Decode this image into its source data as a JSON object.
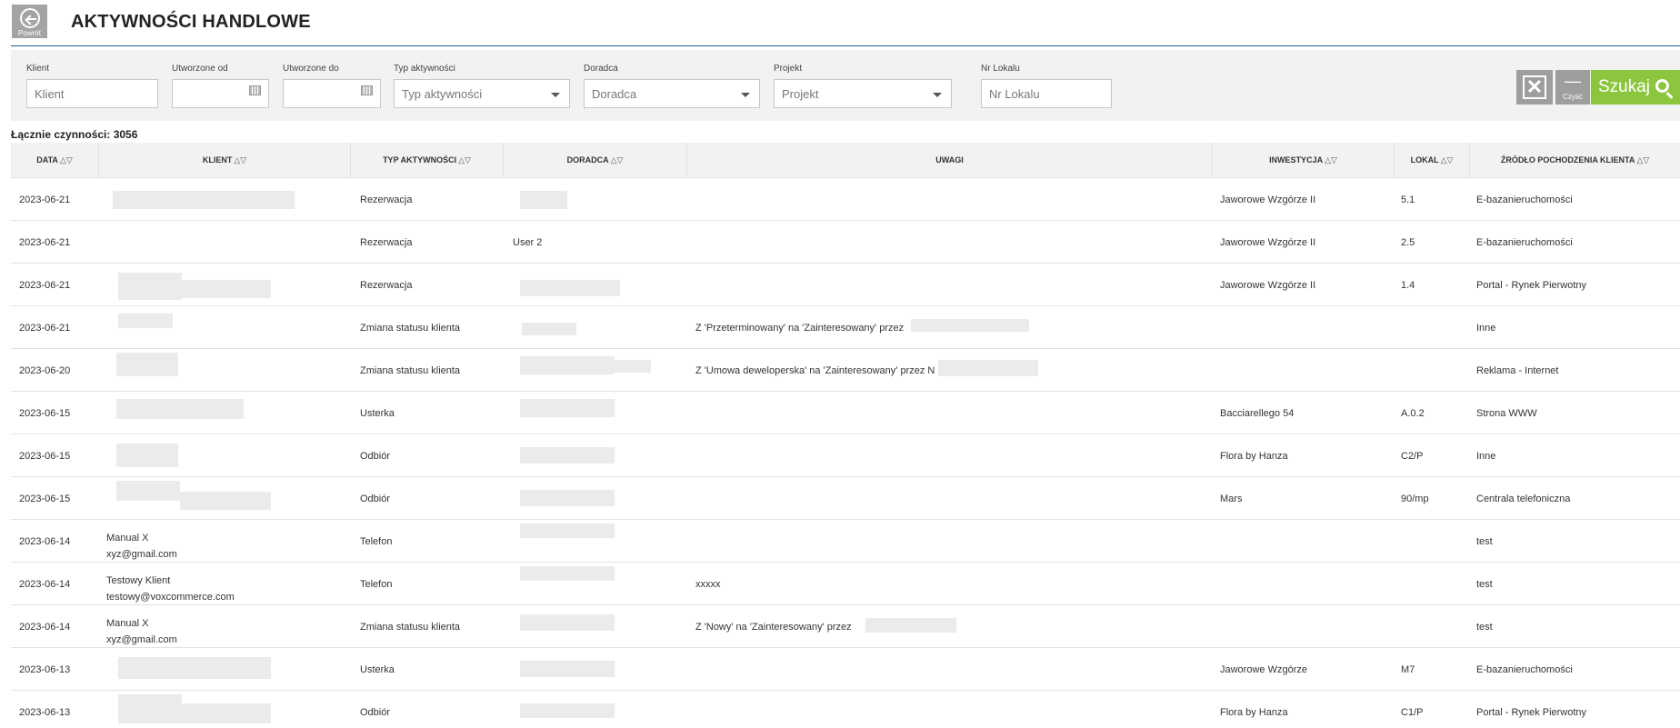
{
  "header": {
    "back_label": "Powrót",
    "title": "AKTYWNOŚCI HANDLOWE"
  },
  "filters": {
    "klient": {
      "label": "Klient",
      "placeholder": "Klient"
    },
    "utworzone_od": {
      "label": "Utworzone od",
      "value": ""
    },
    "utworzone_do": {
      "label": "Utworzone do",
      "value": ""
    },
    "typ": {
      "label": "Typ aktywności",
      "placeholder": "Typ aktywności"
    },
    "doradca": {
      "label": "Doradca",
      "placeholder": "Doradca"
    },
    "projekt": {
      "label": "Projekt",
      "placeholder": "Projekt"
    },
    "nr_lokalu": {
      "label": "Nr Lokalu",
      "placeholder": "Nr Lokalu"
    },
    "clear_label": "Czyść",
    "search_label": "Szukaj"
  },
  "count_text": "Łącznie czynności: 3056",
  "columns": {
    "data": "DATA",
    "klient": "KLIENT",
    "typ": "TYP AKTYWNOŚCI",
    "doradca": "DORADCA",
    "uwagi": "UWAGI",
    "inwestycja": "INWESTYCJA",
    "lokal": "LOKAL",
    "zrodlo": "ŹRÓDŁO POCHODZENIA KLIENTA",
    "sort_glyph": "△▽"
  },
  "rows": [
    {
      "date": "2023-06-21",
      "client_name": "",
      "client_email": "",
      "type": "Rezerwacja",
      "advisor": "",
      "notes": "",
      "investment": "Jaworowe Wzgórze II",
      "unit": "5.1",
      "source": "E-bazanieruchomości"
    },
    {
      "date": "2023-06-21",
      "client_name": "",
      "client_email": "",
      "type": "Rezerwacja",
      "advisor": "User 2",
      "notes": "",
      "investment": "Jaworowe Wzgórze II",
      "unit": "2.5",
      "source": "E-bazanieruchomości"
    },
    {
      "date": "2023-06-21",
      "client_name": "",
      "client_email": "",
      "type": "Rezerwacja",
      "advisor": "",
      "notes": "",
      "investment": "Jaworowe Wzgórze II",
      "unit": "1.4",
      "source": "Portal - Rynek Pierwotny"
    },
    {
      "date": "2023-06-21",
      "client_name": "",
      "client_email": "",
      "type": "Zmiana statusu klienta",
      "advisor": "",
      "notes": "Z 'Przeterminowany' na 'Zainteresowany' przez",
      "investment": "",
      "unit": "",
      "source": "Inne"
    },
    {
      "date": "2023-06-20",
      "client_name": "",
      "client_email": "",
      "type": "Zmiana statusu klienta",
      "advisor": "",
      "notes": "Z 'Umowa deweloperska' na 'Zainteresowany' przez N",
      "investment": "",
      "unit": "",
      "source": "Reklama - Internet"
    },
    {
      "date": "2023-06-15",
      "client_name": "",
      "client_email": "",
      "type": "Usterka",
      "advisor": "",
      "notes": "",
      "investment": "Bacciarellego 54",
      "unit": "A.0.2",
      "source": "Strona WWW"
    },
    {
      "date": "2023-06-15",
      "client_name": "",
      "client_email": "",
      "type": "Odbiór",
      "advisor": "",
      "notes": "",
      "investment": "Flora by Hanza",
      "unit": "C2/P",
      "source": "Inne"
    },
    {
      "date": "2023-06-15",
      "client_name": "",
      "client_email": "",
      "type": "Odbiór",
      "advisor": "",
      "notes": "",
      "investment": "Mars",
      "unit": "90/mp",
      "source": "Centrala telefoniczna"
    },
    {
      "date": "2023-06-14",
      "client_name": "Manual X",
      "client_email": "xyz@gmail.com",
      "type": "Telefon",
      "advisor": "",
      "notes": "",
      "investment": "",
      "unit": "",
      "source": "test"
    },
    {
      "date": "2023-06-14",
      "client_name": "Testowy Klient",
      "client_email": "testowy@voxcommerce.com",
      "type": "Telefon",
      "advisor": "",
      "notes": "xxxxx",
      "investment": "",
      "unit": "",
      "source": "test"
    },
    {
      "date": "2023-06-14",
      "client_name": "Manual X",
      "client_email": "xyz@gmail.com",
      "type": "Zmiana statusu klienta",
      "advisor": "",
      "notes": "Z 'Nowy' na 'Zainteresowany' przez",
      "investment": "",
      "unit": "",
      "source": "test"
    },
    {
      "date": "2023-06-13",
      "client_name": "",
      "client_email": "",
      "type": "Usterka",
      "advisor": "",
      "notes": "",
      "investment": "Jaworowe Wzgórze",
      "unit": "M7",
      "source": "E-bazanieruchomości"
    },
    {
      "date": "2023-06-13",
      "client_name": "",
      "client_email": "",
      "type": "Odbiór",
      "advisor": "",
      "notes": "",
      "investment": "Flora by Hanza",
      "unit": "C1/P",
      "source": "Portal - Rynek Pierwotny"
    }
  ]
}
